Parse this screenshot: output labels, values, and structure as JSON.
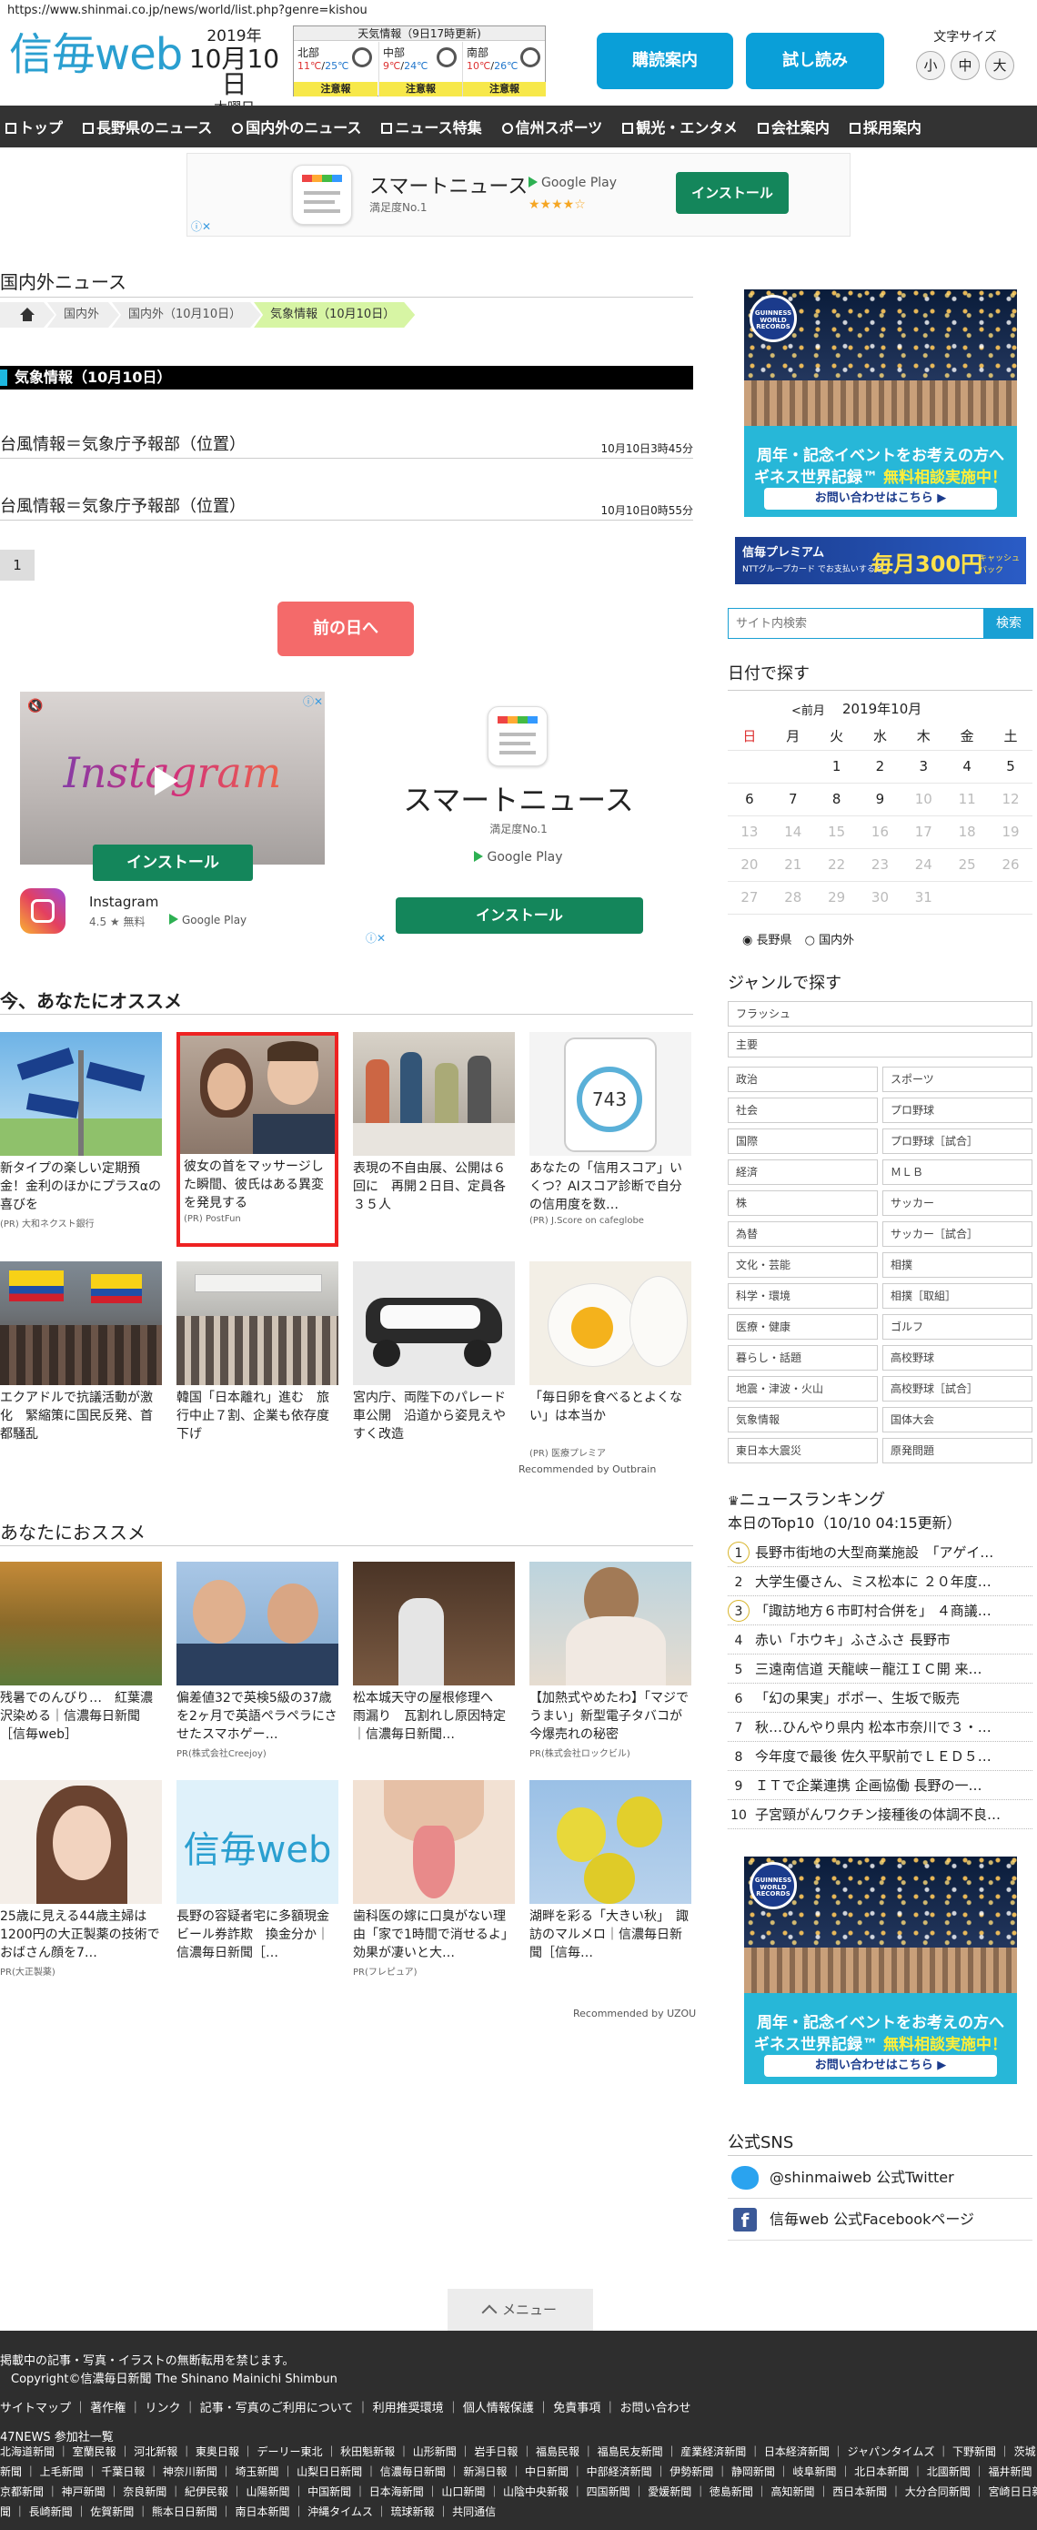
{
  "url": "https://www.shinmai.co.jp/news/world/list.php?genre=kishou",
  "logo": {
    "kanji": "信毎",
    "web": "web"
  },
  "date": {
    "year": "2019年",
    "monthday": "10月10日",
    "weekday": "木曜日"
  },
  "weather": {
    "title": "天気情報（9日17時更新)",
    "areas": [
      {
        "name": "北部",
        "high": "11℃",
        "low": "25℃",
        "warn": "注意報"
      },
      {
        "name": "中部",
        "high": "9℃",
        "low": "24℃",
        "warn": "注意報"
      },
      {
        "name": "南部",
        "high": "10℃",
        "low": "26℃",
        "warn": "注意報"
      }
    ]
  },
  "buttons": {
    "delivery": "購読案内",
    "trial": "試し読み"
  },
  "fontsize": {
    "label": "文字サイズ",
    "small": "小",
    "mid": "中",
    "large": "大"
  },
  "nav": [
    "トップ",
    "長野県のニュース",
    "国内外のニュース",
    "ニュース特集",
    "信州スポーツ",
    "観光・エンタメ",
    "会社案内",
    "採用案内"
  ],
  "adtop": {
    "title": "スマートニュース",
    "sub": "満足度No.1",
    "gplay": "Google Play",
    "install": "インストール",
    "rating": "★★★★☆"
  },
  "section_title": "国内外ニュース",
  "breadcrumbs": [
    "国内外",
    "国内外（10月10日）",
    "気象情報（10月10日）"
  ],
  "category_header": "気象情報（10月10日）",
  "articles": [
    {
      "title": "台風情報＝気象庁予報部（位置）",
      "date": "10月10日3時45分"
    },
    {
      "title": "台風情報＝気象庁予報部（位置）",
      "date": "10月10日0時55分"
    }
  ],
  "page_number": "1",
  "prev_day": "前の日へ",
  "insta_ad": {
    "word": "Instagram",
    "install": "インストール",
    "name": "Instagram",
    "meta": "4.5 ★ 無料",
    "gplay": "Google Play"
  },
  "smart_ad": {
    "title": "スマートニュース",
    "sub": "満足度No.1",
    "gplay": "Google Play",
    "install": "インストール"
  },
  "rec1": {
    "title": "今、あなたにオススメ",
    "items": [
      {
        "caption": "新タイプの楽しい定期預金！金利のほかにプラスαの喜びを",
        "pr": "(PR) 大和ネクスト銀行"
      },
      {
        "caption": "彼女の首をマッサージした瞬間、彼氏はある異変を発見する",
        "pr": "(PR) PostFun"
      },
      {
        "caption": "表現の不自由展、公開は６回に　再開２日目、定員各３５人",
        "pr": ""
      },
      {
        "caption": "あなたの「信用スコア」いくつ？AIスコア診断で自分の信用度を数…",
        "pr": "(PR) J.Score on cafeglobe"
      },
      {
        "caption": "エクアドルで抗議活動が激化　緊縮策に国民反発、首都騒乱",
        "pr": ""
      },
      {
        "caption": "韓国「日本離れ」進む　旅行中止７割、企業も依存度下げ",
        "pr": ""
      },
      {
        "caption": "宮内庁、両陛下のパレード車公開　沿道から姿見えやすく改造",
        "pr": ""
      },
      {
        "caption": "「毎日卵を食べるとよくない」は本当か",
        "pr": "(PR) 医療プレミア"
      }
    ],
    "credit": "Recommended by Outbrain"
  },
  "rec2": {
    "title": "あなたにおススメ",
    "items": [
      {
        "caption": "残暑でのんびり…　紅葉濃沢染める｜信濃毎日新聞［信毎web］",
        "pr": ""
      },
      {
        "caption": "偏差値32で英検5級の37歳を2ヶ月で英語ペラペラにさせたスマホゲー…",
        "pr": "PR(株式会社Creejoy)"
      },
      {
        "caption": "松本城天守の屋根修理へ　雨漏り　瓦割れし原因特定｜信濃毎日新聞…",
        "pr": ""
      },
      {
        "caption": "【加熱式やめたわ】「マジでうまい」新型電子タバコが今爆売れの秘密",
        "pr": "PR(株式会社ロックビル)"
      },
      {
        "caption": "25歳に見える44歳主婦は1200円の大正製薬の技術でおばさん顔を7…",
        "pr": "PR(大正製薬)"
      },
      {
        "caption": "長野の容疑者宅に多額現金　ビール券詐欺　換金分か｜信濃毎日新聞［…",
        "pr": ""
      },
      {
        "caption": "歯科医の嫁に口臭がない理由「家で1時間で消せるよ」効果が凄いと大…",
        "pr": "PR(フレピュア)"
      },
      {
        "caption": "湖畔を彩る「大きい秋」　諏訪のマルメロ｜信濃毎日新聞［信毎…",
        "pr": ""
      }
    ],
    "credit": "Recommended by UZOU"
  },
  "sidebar": {
    "guinness": {
      "seal": "GUINNESS WORLD RECORDS",
      "l1": "周年・記念イベントをお考えの方へ",
      "l2a": "ギネス世界記録™",
      "l2b": "無料相談実施中！",
      "btn": "お問い合わせはこちら ▶"
    },
    "premium": {
      "label": "信毎プレミアム",
      "sub": "NTTグループカード でお支払いすると",
      "price": "毎月300円",
      "tail": "キャッシュバック"
    },
    "search_placeholder": "サイト内検索",
    "search_btn": "検索",
    "date_title": "日付で探す",
    "cal_prev": "<前月",
    "cal_month": "2019年10月",
    "weekdays": [
      "日",
      "月",
      "火",
      "水",
      "木",
      "金",
      "土"
    ],
    "cal_rows": [
      [
        "",
        "",
        "1",
        "2",
        "3",
        "4",
        "5"
      ],
      [
        "6",
        "7",
        "8",
        "9",
        "10",
        "11",
        "12"
      ],
      [
        "13",
        "14",
        "15",
        "16",
        "17",
        "18",
        "19"
      ],
      [
        "20",
        "21",
        "22",
        "23",
        "24",
        "25",
        "26"
      ],
      [
        "27",
        "28",
        "29",
        "30",
        "31",
        "",
        ""
      ]
    ],
    "radio": [
      "長野県",
      "国内外"
    ],
    "genre_title": "ジャンルで探す",
    "genre_full": [
      "フラッシュ",
      "主要"
    ],
    "genres": [
      "政治",
      "スポーツ",
      "社会",
      "プロ野球",
      "国際",
      "プロ野球［試合］",
      "経済",
      "ＭＬＢ",
      "株",
      "サッカー",
      "為替",
      "サッカー［試合］",
      "文化・芸能",
      "相撲",
      "科学・環境",
      "相撲［取組］",
      "医療・健康",
      "ゴルフ",
      "暮らし・話題",
      "高校野球",
      "地震・津波・火山",
      "高校野球［試合］",
      "気象情報",
      "国体大会",
      "東日本大震災",
      "原発問題"
    ],
    "ranking_title": "ニュースランキング",
    "ranking_sub": "本日のTop10（10/10 04:15更新）",
    "ranking": [
      "長野市街地の大型商業施設　「アゲイ…",
      "大学生優さん、ミス松本に ２０年度…",
      "「諏訪地方６市町村合併を」 ４商議…",
      "赤い「ホウキ」ふさふさ 長野市",
      "三遠南信道 天龍峡－龍江ＩＣ開 来…",
      "「幻の果実」ポポー、生坂で販売",
      "秋…ひんやり県内 松本市奈川で３・…",
      "今年度で最後 佐久平駅前でＬＥＤ５…",
      "ＩＴで企業連携 企画協働 長野の一…",
      "子宮頸がんワクチン接種後の体調不良…"
    ],
    "sns_title": "公式SNS",
    "twitter": "@shinmaiweb 公式Twitter",
    "facebook": "信毎web 公式Facebookページ"
  },
  "footer": {
    "menu": "メニュー",
    "notice": "掲載中の記事・写真・イラストの無断転用を禁じます。",
    "copyright": "Copyright©信濃毎日新聞 The Shinano Mainichi Shimbun",
    "links": "サイトマップ ｜ 著作権 ｜ リンク ｜ 記事・写真のご利用について ｜ 利用推奨環境 ｜ 個人情報保護 ｜ 免責事項 ｜ お問い合わせ",
    "papers_title": "47NEWS 参加社一覧",
    "papers1": "北海道新聞 ｜ 室蘭民報 ｜ 河北新報 ｜ 東奥日報 ｜ デーリー東北 ｜ 秋田魁新報 ｜ 山形新聞 ｜ 岩手日報 ｜ 福島民報 ｜ 福島民友新聞 ｜ 産業経済新聞 ｜ 日本経済新聞 ｜ ジャパンタイムズ ｜ 下野新聞 ｜ 茨城",
    "papers2": "新聞 ｜ 上毛新聞 ｜ 千葉日報 ｜ 神奈川新聞 ｜ 埼玉新聞 ｜ 山梨日日新聞 ｜ 信濃毎日新聞 ｜ 新潟日報 ｜ 中日新聞 ｜ 中部経済新聞 ｜ 伊勢新聞 ｜ 静岡新聞 ｜ 岐阜新聞 ｜ 北日本新聞 ｜ 北國新聞 ｜ 福井新聞 ｜",
    "papers3": "京都新聞 ｜ 神戸新聞 ｜ 奈良新聞 ｜ 紀伊民報 ｜ 山陽新聞 ｜ 中国新聞 ｜ 日本海新聞 ｜ 山口新聞 ｜ 山陰中央新報 ｜ 四国新聞 ｜ 愛媛新聞 ｜ 徳島新聞 ｜ 高知新聞 ｜ 西日本新聞 ｜ 大分合同新聞 ｜ 宮崎日日新",
    "papers4": "聞 ｜ 長崎新聞 ｜ 佐賀新聞 ｜ 熊本日日新聞 ｜ 南日本新聞 ｜ 沖縄タイムス ｜ 琉球新報 ｜ 共同通信"
  }
}
